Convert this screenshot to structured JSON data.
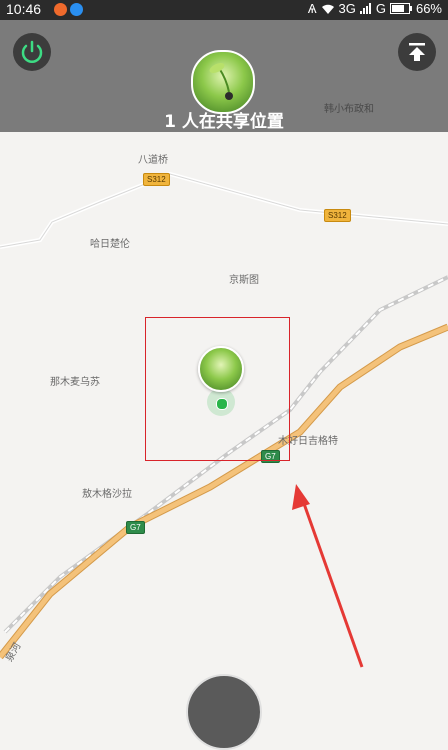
{
  "status_bar": {
    "time": "10:46",
    "network": "3G",
    "network2": "G",
    "battery": "66%"
  },
  "header": {
    "share_text": "1 人在共享位置",
    "top_place": "韩小布政和"
  },
  "map": {
    "places": {
      "badaoqiao": "八道桥",
      "harimutai": "哈日楚伦",
      "jingsitu": "京斯图",
      "namumai": "那木麦乌苏",
      "muhaoguo": "木好日吉格特",
      "aomugesala": "敖木格沙拉",
      "river": "泉河"
    },
    "roads": {
      "s312_a": "S312",
      "s312_b": "S312",
      "g7_a": "G7",
      "g7_b": "G7"
    }
  },
  "colors": {
    "header_bg": "#7b7b7b",
    "highlight": "#d8232a",
    "arrow": "#e53935",
    "expressway": "#f4c27a",
    "location_dot": "#29b54a"
  }
}
